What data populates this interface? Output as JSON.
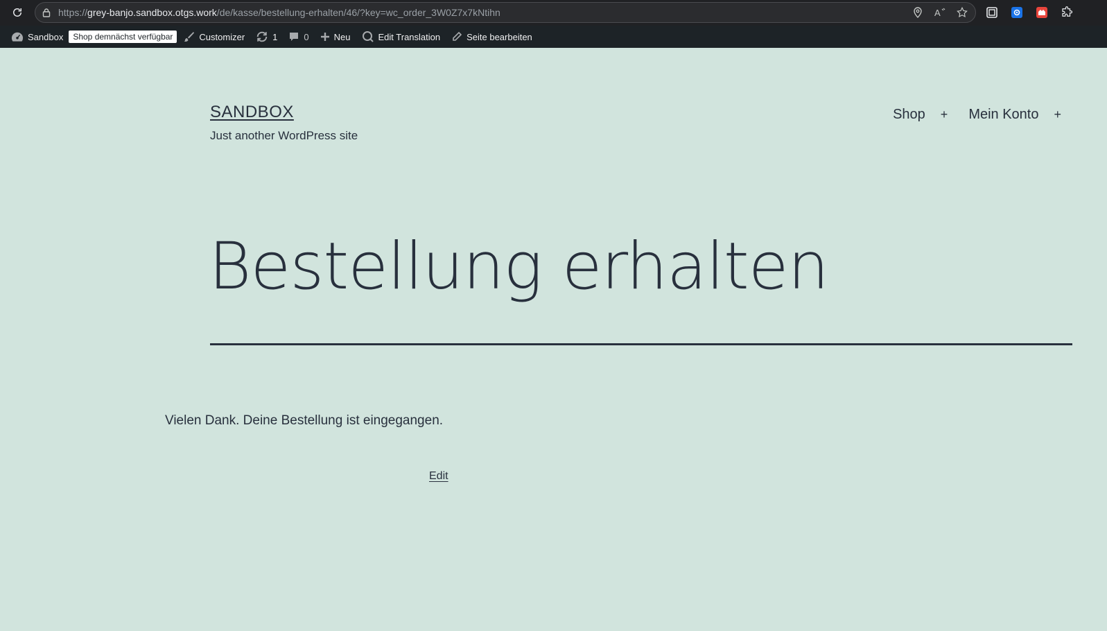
{
  "browser": {
    "url_scheme": "https://",
    "url_host": "grey-banjo.sandbox.otgs.work",
    "url_path": "/de/kasse/bestellung-erhalten/46/?key=wc_order_3W0Z7x7kNtihn"
  },
  "adminbar": {
    "site": "Sandbox",
    "badge": "Shop demnächst verfügbar",
    "customizer": "Customizer",
    "updates_count": "1",
    "comments_count": "0",
    "new": "Neu",
    "edit_translation": "Edit Translation",
    "edit_page": "Seite bearbeiten"
  },
  "site": {
    "title": "SANDBOX",
    "description": "Just another WordPress site"
  },
  "nav": {
    "items": [
      {
        "label": "Shop",
        "toggle": "+"
      },
      {
        "label": "Mein Konto",
        "toggle": "+"
      }
    ]
  },
  "main": {
    "page_title": "Bestellung erhalten",
    "thanks": "Vielen Dank. Deine Bestellung ist eingegangen.",
    "edit": "Edit"
  },
  "colors": {
    "background": "#d1e4dd",
    "text": "#28303d",
    "adminbar": "#1d2327"
  }
}
